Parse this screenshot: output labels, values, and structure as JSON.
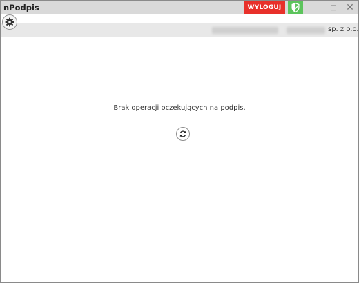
{
  "window": {
    "title": "nPodpis",
    "logout_label": "WYLOGUJ",
    "controls": {
      "minimize_icon": "minimize-icon",
      "maximize_icon": "maximize-icon",
      "close_icon": "close-icon",
      "minimize_glyph": "–",
      "maximize_glyph": "□",
      "close_glyph": "✕"
    },
    "security_icon": "shield-check-icon"
  },
  "toolbar": {
    "settings_icon": "gear-icon",
    "company_suffix": "sp. z o.o."
  },
  "main": {
    "status_message": "Brak operacji oczekujących na podpis.",
    "refresh_icon": "refresh-icon"
  },
  "colors": {
    "logout_bg": "#e8302a",
    "security_bg": "#5cc45c",
    "titlebar_bg": "#d9d9d9",
    "toolbar_bg": "#e8e8e8"
  }
}
